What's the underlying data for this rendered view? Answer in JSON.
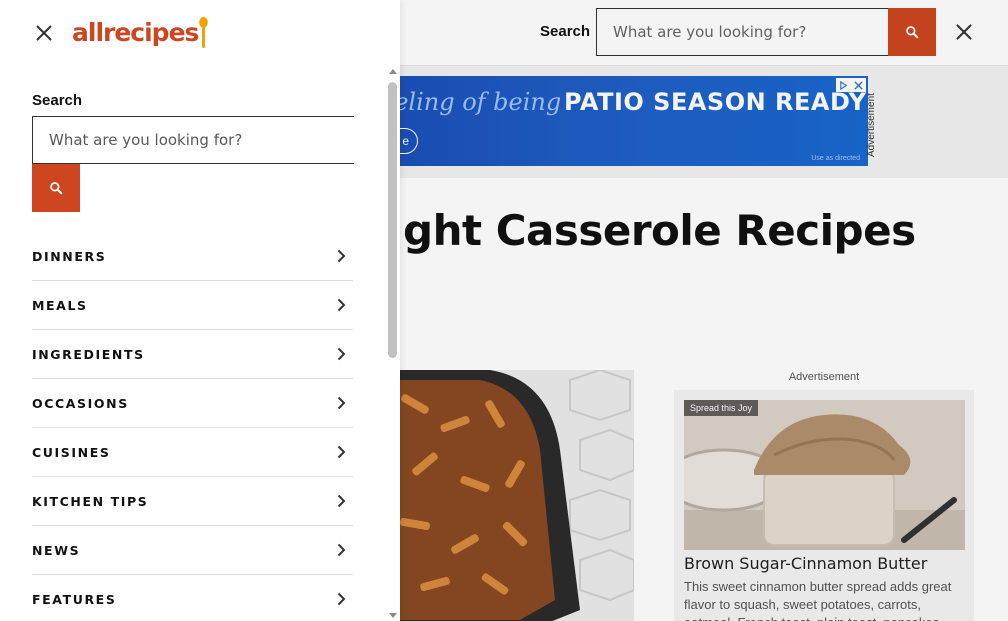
{
  "background": {
    "search_label": "Search",
    "search_placeholder": "What are you looking for?",
    "ad": {
      "text_italic": "eeling of being",
      "text_bold": "PATIO SEASON READY",
      "pill_text": "e",
      "disclaimer": "Use as directed",
      "vertical_label": "Advertisement"
    },
    "page_title": "Weeknight Casserole Recipes",
    "right_ad_label": "Advertisement",
    "right_card": {
      "badge": "Spread this Joy",
      "title": "Brown Sugar-Cinnamon Butter",
      "description": "This sweet cinnamon butter spread adds great flavor to squash, sweet potatoes, carrots, oatmeal, French toast, plain toast, pancakes"
    }
  },
  "drawer": {
    "logo_text": "allrecipes",
    "search_label": "Search",
    "search_placeholder": "What are you looking for?",
    "nav_items": [
      {
        "label": "DINNERS"
      },
      {
        "label": "MEALS"
      },
      {
        "label": "INGREDIENTS"
      },
      {
        "label": "OCCASIONS"
      },
      {
        "label": "CUISINES"
      },
      {
        "label": "KITCHEN TIPS"
      },
      {
        "label": "NEWS"
      },
      {
        "label": "FEATURES"
      }
    ]
  },
  "colors": {
    "brand": "#ce4620",
    "text": "#111111",
    "divider": "#dedede"
  },
  "icons": {
    "close": "close-icon",
    "search": "search-icon",
    "chevron": "chevron-right-icon",
    "logo": "spoon-icon"
  }
}
